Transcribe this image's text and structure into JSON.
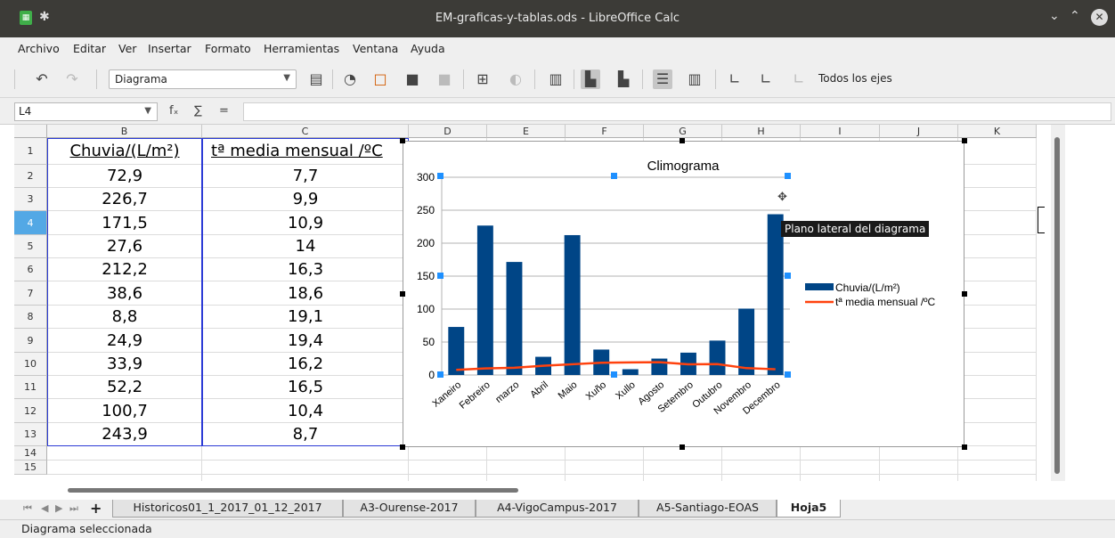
{
  "window": {
    "title": "EM-graficas-y-tablas.ods - LibreOffice Calc"
  },
  "menu": [
    "Archivo",
    "Editar",
    "Ver",
    "Insertar",
    "Formato",
    "Herramientas",
    "Ventana",
    "Ayuda"
  ],
  "toolbar": {
    "element_combo": "Diagrama",
    "all_axes_label": "Todos los ejes"
  },
  "formula": {
    "cell_ref": "L4",
    "fx": "fₓ",
    "sum": "∑",
    "eq": "="
  },
  "columns": [
    "B",
    "C",
    "D",
    "E",
    "F",
    "G",
    "H",
    "I",
    "J",
    "K"
  ],
  "rows": [
    "1",
    "2",
    "3",
    "4",
    "5",
    "6",
    "7",
    "8",
    "9",
    "10",
    "11",
    "12",
    "13",
    "14",
    "15"
  ],
  "selected_row": "4",
  "cells": {
    "b_header": "Chuvia/(L/m²)",
    "c_header": "tª media mensual /ºC",
    "b_values": [
      "72,9",
      "226,7",
      "171,5",
      "27,6",
      "212,2",
      "38,6",
      "8,8",
      "24,9",
      "33,9",
      "52,2",
      "100,7",
      "243,9"
    ],
    "c_values": [
      "7,7",
      "9,9",
      "10,9",
      "14",
      "16,3",
      "18,6",
      "19,1",
      "19,4",
      "16,2",
      "16,5",
      "10,4",
      "8,7"
    ]
  },
  "chart_data": {
    "type": "bar",
    "title": "Climograma",
    "categories": [
      "Xaneiro",
      "Febreiro",
      "marzo",
      "Abril",
      "Maio",
      "Xuño",
      "Xullo",
      "Agosto",
      "Setembro",
      "Outubro",
      "Novembro",
      "Decembro"
    ],
    "series": [
      {
        "name": "Chuvia/(L/m²)",
        "type": "bar",
        "color": "#004586",
        "values": [
          72.9,
          226.7,
          171.5,
          27.6,
          212.2,
          38.6,
          8.8,
          24.9,
          33.9,
          52.2,
          100.7,
          243.9
        ]
      },
      {
        "name": "tª media mensual /ºC",
        "type": "line",
        "color": "#ff420e",
        "values": [
          7.7,
          9.9,
          10.9,
          14,
          16.3,
          18.6,
          19.1,
          19.4,
          16.2,
          16.5,
          10.4,
          8.7
        ]
      }
    ],
    "yticks": [
      "0",
      "50",
      "100",
      "150",
      "200",
      "250",
      "300"
    ],
    "ylim": [
      0,
      300
    ],
    "grid": true,
    "legend": "right"
  },
  "tooltip": "Plano lateral del diagrama",
  "sheets": [
    "Historicos01_1_2017_01_12_2017",
    "A3-Ourense-2017",
    "A4-VigoCampus-2017",
    "A5-Santiago-EOAS",
    "Hoja5"
  ],
  "active_sheet": "Hoja5",
  "status": "Diagrama seleccionada"
}
